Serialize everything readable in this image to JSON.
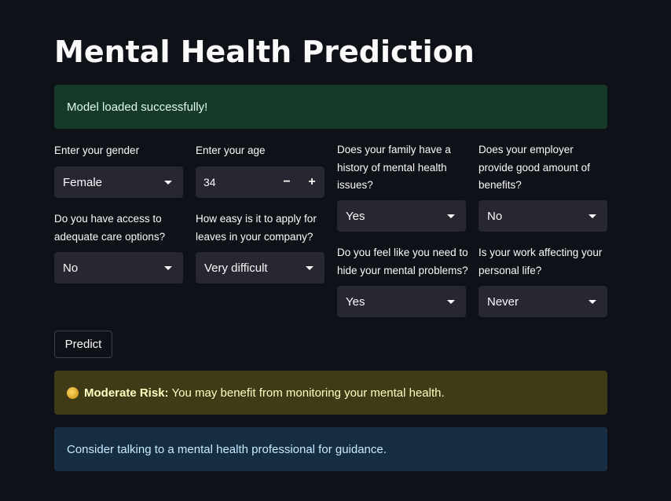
{
  "title": "Mental Health Prediction",
  "status_message": "Model loaded successfully!",
  "fields": {
    "gender": {
      "label": "Enter your gender",
      "value": "Female"
    },
    "age": {
      "label": "Enter your age",
      "value": "34",
      "minus": "−",
      "plus": "+"
    },
    "family_history": {
      "label": "Does your family have a history of mental health issues?",
      "value": "Yes"
    },
    "benefits": {
      "label": "Does your employer provide good amount of benefits?",
      "value": "No"
    },
    "care_options": {
      "label": "Do you have access to adequate care options?",
      "value": "No"
    },
    "leave": {
      "label": "How easy is it to apply for leaves in your company?",
      "value": "Very difficult"
    },
    "hide_problems": {
      "label": "Do you feel like you need to hide your mental problems?",
      "value": "Yes"
    },
    "work_interfere": {
      "label": "Is your work affecting your personal life?",
      "value": "Never"
    }
  },
  "predict_button": "Predict",
  "result": {
    "icon": "yellow-circle-icon",
    "risk_label": "Moderate Risk:",
    "risk_text": "You may benefit from monitoring your mental health."
  },
  "advice": "Consider talking to a mental health professional for guidance.",
  "colors": {
    "background": "#0e1117",
    "success_bg": "#173928",
    "warning_bg": "#3e3b16",
    "info_bg": "#172d43",
    "input_bg": "#262730"
  }
}
